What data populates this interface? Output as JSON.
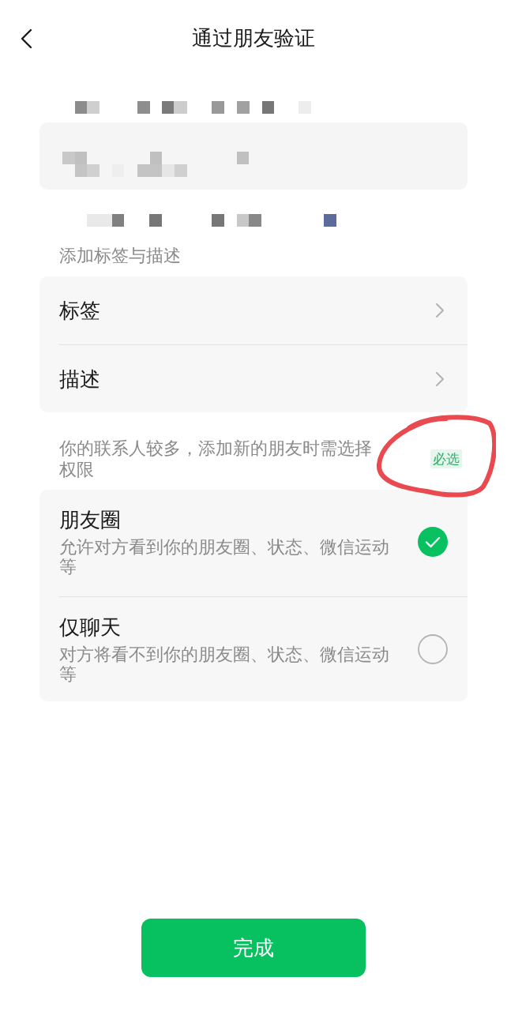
{
  "header": {
    "title": "通过朋友验证"
  },
  "remark_field": {
    "pixelated": true
  },
  "tag_section": {
    "heading": "添加标签与描述",
    "items": [
      {
        "label": "标签"
      },
      {
        "label": "描述"
      }
    ]
  },
  "permission_section": {
    "note": "你的联系人较多，添加新的朋友时需选择权限",
    "badge": "必选",
    "options": [
      {
        "title": "朋友圈",
        "description": "允许对方看到你的朋友圈、状态、微信运动等",
        "selected": true
      },
      {
        "title": "仅聊天",
        "description": "对方将看不到你的朋友圈、状态、微信运动等",
        "selected": false
      }
    ]
  },
  "annotations": [
    {
      "kind": "circle"
    }
  ],
  "done_button": {
    "label": "完成"
  }
}
